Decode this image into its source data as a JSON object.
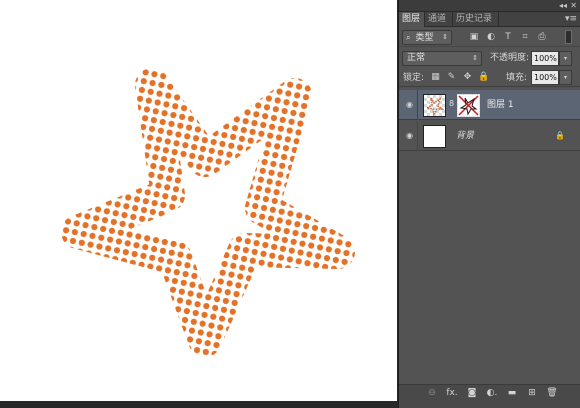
{
  "panel": {
    "collapse_glyph": "◂◂",
    "close_glyph": "✕",
    "menu_glyph": "▾≡",
    "tabs": [
      {
        "label": "图层",
        "active": true
      },
      {
        "label": "通道",
        "active": false
      },
      {
        "label": "历史记录",
        "active": false
      }
    ],
    "filter": {
      "search_glyph": "⌕",
      "kind_label": "类型",
      "arrows_glyph": "⇕",
      "icons": [
        "image-filter-icon",
        "adjustment-filter-icon",
        "type-filter-icon",
        "shape-filter-icon",
        "smart-object-filter-icon"
      ],
      "icon_glyphs": [
        "▣",
        "◐",
        "T",
        "⌗",
        "⎙"
      ]
    },
    "blend": {
      "mode": "正常",
      "arrows_glyph": "⇕",
      "opacity_label": "不透明度:",
      "opacity_value": "100%",
      "dropdown_glyph": "▾"
    },
    "lock": {
      "label": "锁定:",
      "icon_glyphs": [
        "▦",
        "✎",
        "✥",
        "🔒"
      ],
      "fill_label": "填充:",
      "fill_value": "100%",
      "dropdown_glyph": "▾"
    },
    "layers": [
      {
        "name": "图层 1",
        "visible": true,
        "selected": true,
        "has_mask": true,
        "locked": false
      },
      {
        "name": "背景",
        "visible": true,
        "selected": false,
        "has_mask": false,
        "locked": true
      }
    ],
    "eye_glyph": "◉",
    "link_glyph": "8",
    "lock_glyph": "🔒",
    "bottom_bar": {
      "icons": [
        "link-layers-icon",
        "fx-icon",
        "add-mask-icon",
        "adjustment-layer-icon",
        "new-group-icon",
        "new-layer-icon",
        "delete-layer-icon"
      ],
      "glyphs": [
        "⊖",
        "fx.",
        "◙",
        "◐.",
        "▬",
        "⊞",
        "🗑"
      ]
    }
  },
  "colors": {
    "gradient_start": "#e8891a",
    "gradient_end": "#8c1c8c",
    "panel_bg": "#535353",
    "selected_row": "#5b6574"
  }
}
